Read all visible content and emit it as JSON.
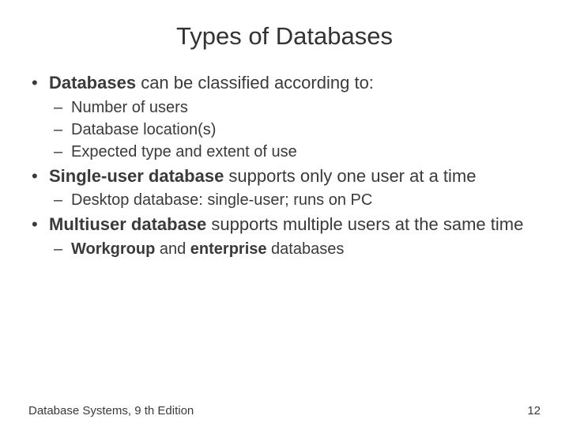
{
  "title": "Types of Databases",
  "bullets": {
    "b1_bold": "Databases",
    "b1_rest": " can be classified according to:",
    "b1_sub1": "Number of users",
    "b1_sub2": "Database location(s)",
    "b1_sub3": "Expected type and extent of use",
    "b2_bold": "Single-user database",
    "b2_rest": " supports only one user at a time",
    "b2_sub1": "Desktop database: single-user; runs on PC",
    "b3_bold": "Multiuser database",
    "b3_rest": " supports multiple users at the same time",
    "b3_sub1_bold": "Workgroup",
    "b3_sub1_mid": " and ",
    "b3_sub1_bold2": "enterprise",
    "b3_sub1_rest": " databases"
  },
  "footer": {
    "left": "Database Systems, 9 th Edition",
    "right": "12"
  }
}
